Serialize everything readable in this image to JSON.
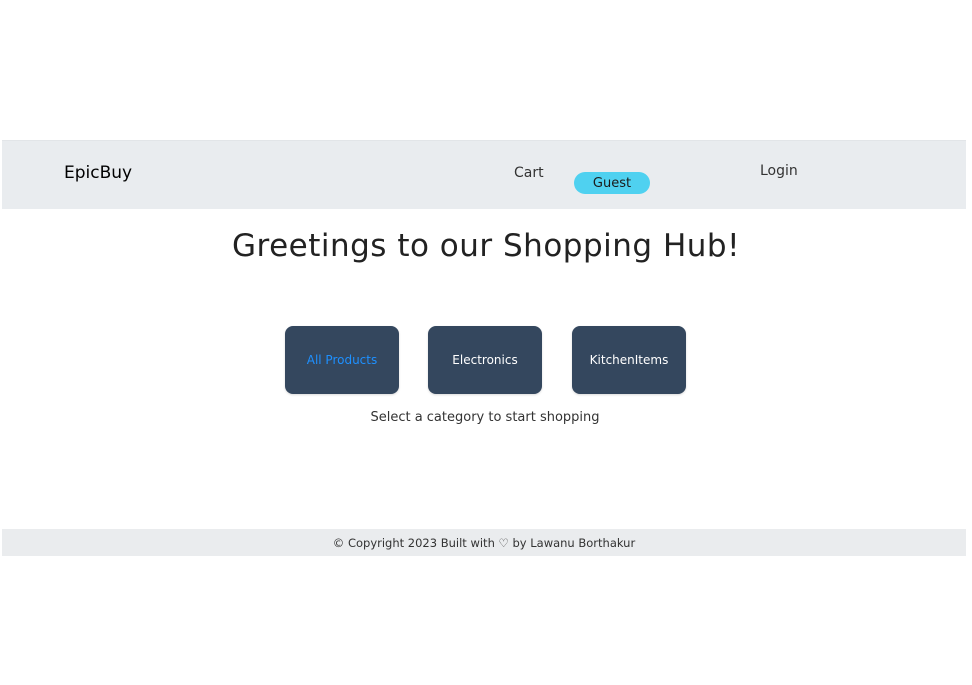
{
  "navbar": {
    "brand": "EpicBuy",
    "cart_label": "Cart",
    "guest_label": "Guest",
    "login_label": "Login"
  },
  "main": {
    "heading": "Greetings to our Shopping Hub!",
    "categories": [
      {
        "label": "All Products",
        "active": true
      },
      {
        "label": "Electronics",
        "active": false
      },
      {
        "label": "KitchenItems",
        "active": false
      }
    ],
    "subtext": "Select a category to start shopping"
  },
  "footer": {
    "text": "© Copyright 2023 Built with ♡ by Lawanu Borthakur"
  },
  "colors": {
    "navbar_bg": "#e9ecef",
    "guest_badge": "#4fd1f0",
    "category_button": "#34475e",
    "active_category_text": "#1e90ff"
  }
}
